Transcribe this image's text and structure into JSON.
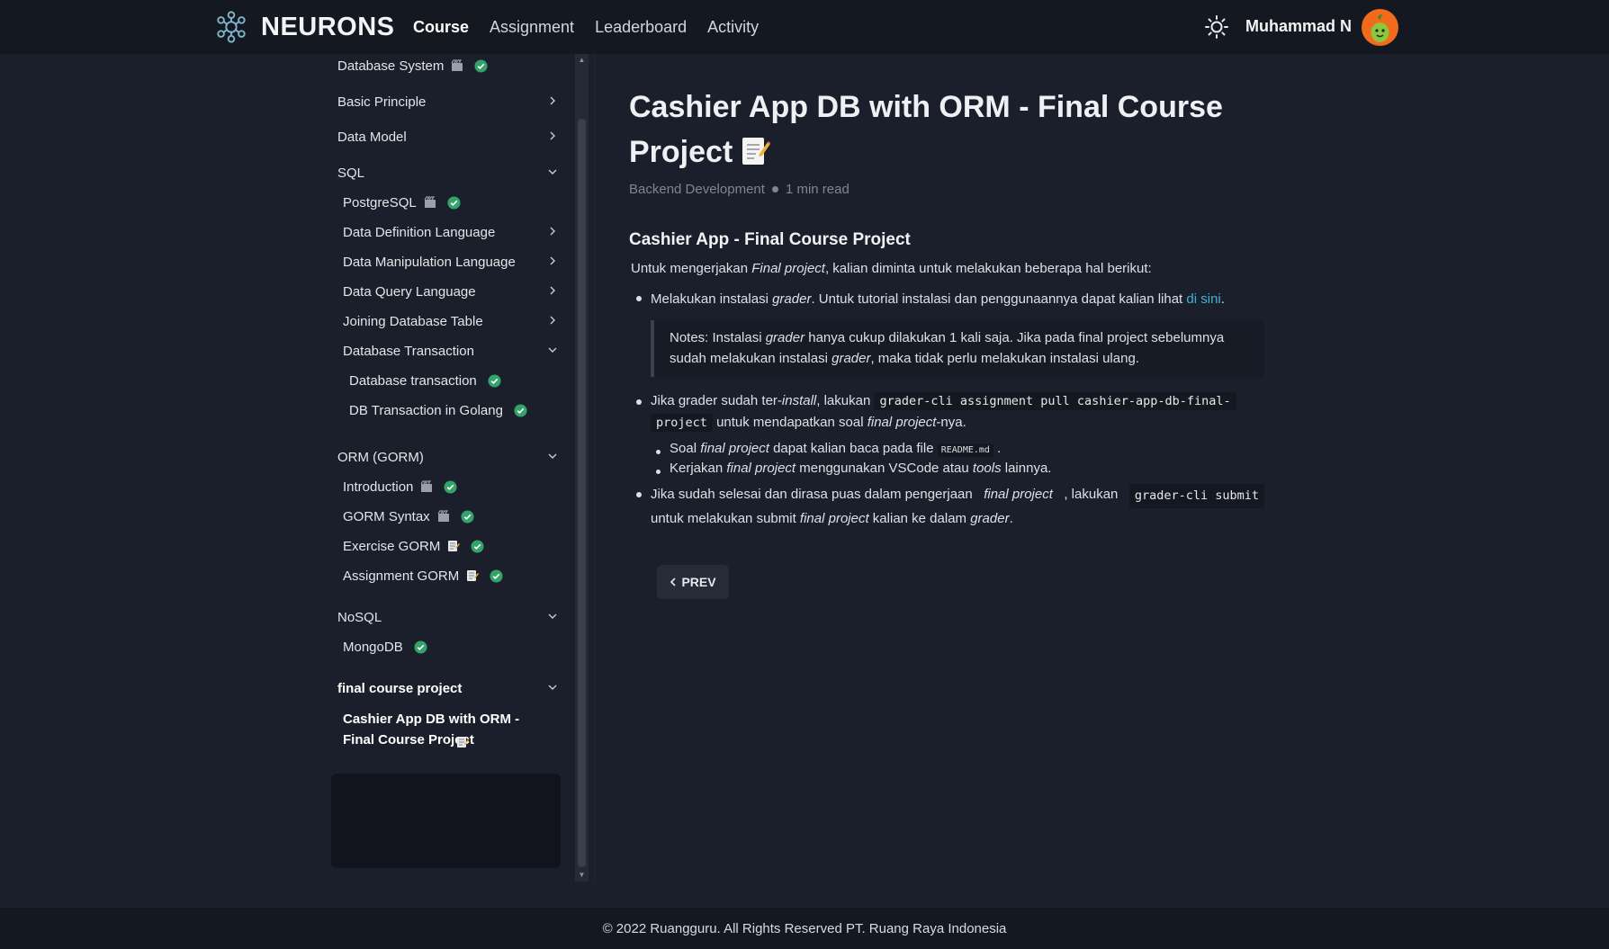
{
  "brand": {
    "name": "NEURONS",
    "accent": "#3fb5d6"
  },
  "nav": {
    "items": [
      {
        "label": "Course",
        "active": true
      },
      {
        "label": "Assignment",
        "active": false
      },
      {
        "label": "Leaderboard",
        "active": false
      },
      {
        "label": "Activity",
        "active": false
      }
    ]
  },
  "user": {
    "name": "Muhammad N"
  },
  "sidebar": {
    "items": [
      {
        "label": "Database System",
        "video": true,
        "done": true,
        "chevron": "none"
      },
      {
        "label": "Basic Principle",
        "chevron": "right"
      },
      {
        "label": "Data Model",
        "chevron": "right"
      },
      {
        "label": "SQL",
        "chevron": "down"
      },
      {
        "label": "PostgreSQL",
        "video": true,
        "done": true,
        "chevron": "none"
      },
      {
        "label": "Data Definition Language",
        "chevron": "right"
      },
      {
        "label": "Data Manipulation Language",
        "chevron": "right"
      },
      {
        "label": "Data Query Language",
        "chevron": "right"
      },
      {
        "label": "Joining Database Table",
        "chevron": "right"
      },
      {
        "label": "Database Transaction",
        "chevron": "down"
      },
      {
        "label": "Database transaction",
        "done": true,
        "chevron": "none"
      },
      {
        "label": "DB Transaction in Golang",
        "done": true,
        "chevron": "none"
      },
      {
        "label": "ORM (GORM)",
        "chevron": "down"
      },
      {
        "label": "Introduction",
        "video": true,
        "done": true,
        "chevron": "none"
      },
      {
        "label": "GORM Syntax",
        "video": true,
        "done": true,
        "chevron": "none"
      },
      {
        "label": "Exercise GORM",
        "doc": true,
        "done": true,
        "chevron": "none"
      },
      {
        "label": "Assignment GORM",
        "doc": true,
        "done": true,
        "chevron": "none"
      },
      {
        "label": "NoSQL",
        "chevron": "down"
      },
      {
        "label": "MongoDB",
        "done": true,
        "chevron": "none"
      },
      {
        "label": "final course project",
        "chevron": "down"
      },
      {
        "label": "Cashier App DB with ORM - Final Course Project",
        "doc": true,
        "active": true
      }
    ]
  },
  "article": {
    "title": "Cashier App DB with ORM - Final Course Project",
    "category": "Backend Development",
    "read_time": "1 min read",
    "heading": "Cashier App - Final Course Project",
    "intro_a": "Untuk mengerjakan ",
    "intro_em": "Final project",
    "intro_b": ", kalian diminta untuk melakukan beberapa hal berikut:",
    "b1_a": "Melakukan instalasi ",
    "b1_em": "grader",
    "b1_b": ". Untuk tutorial instalasi dan penggunaannya dapat kalian lihat ",
    "b1_link": "di sini",
    "b1_c": ".",
    "note_a": "Notes: Instalasi ",
    "note_em1": "grader",
    "note_b": " hanya cukup dilakukan 1 kali saja. Jika pada final project sebelumnya sudah melakukan instalasi ",
    "note_em2": "grader",
    "note_c": ", maka tidak perlu melakukan instalasi ulang.",
    "b2_a": "Jika grader sudah ter-",
    "b2_em": "install",
    "b2_b": ", lakukan ",
    "b2_code1": "grader-cli assignment pull cashier-app-db-final-",
    "b2_code2": "project",
    "b2_c": " untuk mendapatkan soal ",
    "b2_em2": "final project",
    "b2_d": "-nya.",
    "s1_a": "Soal ",
    "s1_em": "final project",
    "s1_b": " dapat kalian baca pada file ",
    "s1_code": "README.md",
    "s1_c": " .",
    "s2_a": "Kerjakan ",
    "s2_em": "final project",
    "s2_b": " menggunakan VSCode atau ",
    "s2_em2": "tools",
    "s2_c": " lainnya.",
    "b3_a": "Jika sudah selesai dan dirasa puas dalam pengerjaan ",
    "b3_em": "final project",
    "b3_b": ", lakukan ",
    "b3_code": "grader-cli submit",
    "b3_c": "untuk melakukan submit ",
    "b3_em2": "final project",
    "b3_d": " kalian ke dalam ",
    "b3_em3": "grader",
    "b3_e": ".",
    "prev_label": "PREV"
  },
  "footer": {
    "text": "© 2022 Ruangguru. All Rights Reserved PT. Ruang Raya Indonesia"
  },
  "icons": {
    "logo": "neuron-logo-icon",
    "theme": "sun-icon",
    "check": "check-badge-icon",
    "video": "clapperboard-icon",
    "doc": "memo-icon",
    "chevron_right": "chevron-right-icon",
    "chevron_down": "chevron-down-icon"
  },
  "colors": {
    "check": "#34a36a",
    "background": "#1a1f2b",
    "topbar": "#141821"
  }
}
